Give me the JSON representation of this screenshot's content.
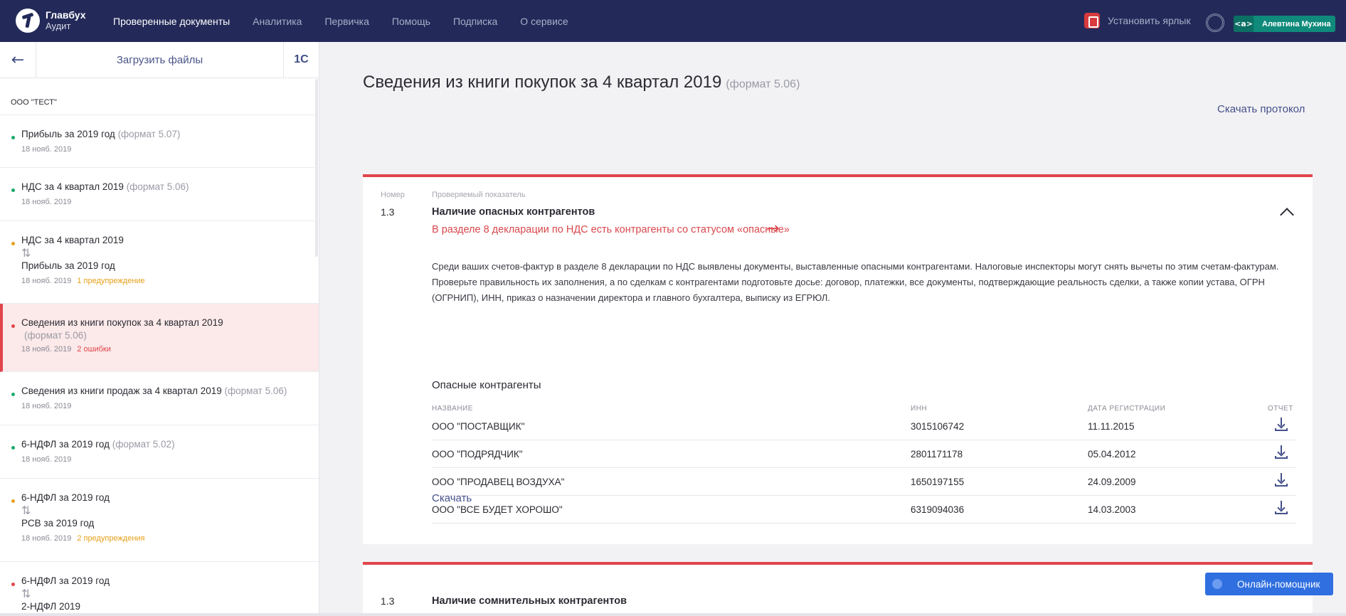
{
  "header": {
    "logo_title": "Главбух",
    "logo_sub": "Аудит",
    "nav": [
      "Проверенные документы",
      "Аналитика",
      "Первичка",
      "Помощь",
      "Подписка",
      "О сервисе"
    ],
    "shortcut_label": "Установить ярлык",
    "user_badge_icon": "<a>",
    "user_name": "Алевтина Мухина"
  },
  "sidebar": {
    "upload_label": "Загрузить файлы",
    "onec_label": "1С",
    "org": "ООО \"ТЕСТ\"",
    "items": [
      {
        "title": "Прибыль за 2019 год",
        "format": "(формат 5.07)",
        "date": "18 нояб. 2019",
        "status": "",
        "dot": "#1aaa6b"
      },
      {
        "title": "НДС за 4 квартал 2019",
        "format": "(формат 5.06)",
        "date": "18 нояб. 2019",
        "status": "",
        "dot": "#1aaa6b"
      },
      {
        "title": "НДС за 4 квартал 2019",
        "title2": "Прибыль за 2019 год",
        "swap": "⇅",
        "date": "18 нояб. 2019",
        "status": "1 предупреждение",
        "dot": "#e6a019"
      },
      {
        "title": "Сведения из книги покупок за 4 квартал 2019",
        "format": "(формат 5.06)",
        "date": "18 нояб. 2019",
        "status": "2 ошибки",
        "dot": "#e0454b"
      },
      {
        "title": "Сведения из книги продаж за 4 квартал 2019",
        "format": "(формат 5.06)",
        "date": "18 нояб. 2019",
        "status": "",
        "dot": "#1aaa6b"
      },
      {
        "title": "6-НДФЛ за 2019 год",
        "format": "(формат 5.02)",
        "date": "18 нояб. 2019",
        "status": "",
        "dot": "#1aaa6b"
      },
      {
        "title": "6-НДФЛ за 2019 год",
        "title2": "РСВ за 2019 год",
        "swap": "⇅",
        "date": "18 нояб. 2019",
        "status": "2 предупреждения",
        "dot": "#e6a019"
      },
      {
        "title": "6-НДФЛ за 2019 год",
        "title2": "2-НДФЛ 2019",
        "swap": "⇅",
        "dot": "#e0454b"
      }
    ]
  },
  "main": {
    "title": "Сведения из книги покупок за 4 квартал 2019",
    "title_format": "(формат 5.06)",
    "protocol_link": "Скачать протокол",
    "card1": {
      "num_label": "Номер",
      "indicator_label": "Проверяемый показатель",
      "num": "1.3",
      "title": "Наличие опасных контрагентов",
      "subtitle": "В разделе 8 декларации по НДС есть контрагенты со статусом «опасные»",
      "description": "Среди ваших счетов-фактур в разделе 8 декларации по НДС выявлены документы, выставленные опасными контрагентами. Налоговые инспекторы могут снять вычеты по этим счетам-фактурам. Проверьте правильность их заполнения, а по сделкам с контрагентами подготовьте досье: договор, платежки, все документы, подтверждающие реальность сделки, а также копии устава, ОГРН (ОГРНИП), ИНН, приказ о назначении директора и главного бухгалтера, выписку из ЕГРЮЛ.",
      "section_title": "Опасные контрагенты",
      "columns": [
        "НАЗВАНИЕ",
        "ИНН",
        "ДАТА РЕГИСТРАЦИИ",
        "ОТЧЕТ"
      ],
      "rows": [
        {
          "name": "ООО \"ПОСТАВЩИК\"",
          "inn": "3015106742",
          "date": "11.11.2015"
        },
        {
          "name": "ООО \"ПОДРЯДЧИК\"",
          "inn": "2801171178",
          "date": "05.04.2012"
        },
        {
          "name": "ООО \"ПРОДАВЕЦ ВОЗДУХА\"",
          "inn": "1650197155",
          "date": "24.09.2009"
        },
        {
          "name": "ООО \"ВСЕ БУДЕТ ХОРОШО\"",
          "inn": "6319094036",
          "date": "14.03.2003"
        }
      ],
      "download_label": "Скачать"
    },
    "card2": {
      "num": "1.3",
      "title": "Наличие сомнительных контрагентов"
    }
  },
  "helper_label": "Онлайн-помощник",
  "colors": {
    "header_bg": "#232a59",
    "accent_red": "#e0454b",
    "ok_green": "#1aaa6b",
    "warn_orange": "#e6a019",
    "link_blue": "#45508a"
  }
}
